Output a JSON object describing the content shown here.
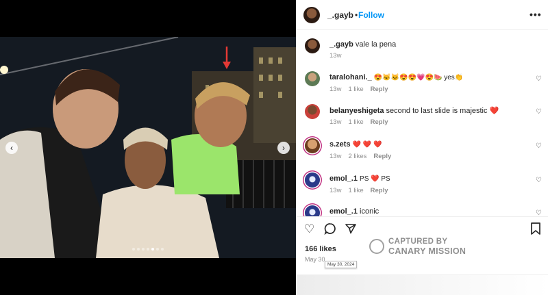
{
  "post": {
    "username": "_.gayb",
    "follow_label": "Follow",
    "separator": "•",
    "more_label": "•••"
  },
  "caption": {
    "username": "_.gayb",
    "text": "vale la pena",
    "age": "13w"
  },
  "comments": [
    {
      "username": "taralohani._",
      "text": "😍🐱🐱😍😍💗😍🍉 yes👏",
      "age": "13w",
      "likes": "1 like",
      "reply": "Reply"
    },
    {
      "username": "belanyeshigeta",
      "text": "second to last slide is majestic ❤️",
      "age": "13w",
      "likes": "1 like",
      "reply": "Reply"
    },
    {
      "username": "s.zets",
      "text": "❤️ ❤️ ❤️",
      "age": "13w",
      "likes": "2 likes",
      "reply": "Reply"
    },
    {
      "username": "emol_.1",
      "text": "PS ❤️ PS",
      "age": "13w",
      "likes": "1 like",
      "reply": "Reply"
    },
    {
      "username": "emol_.1",
      "text": "iconic",
      "age": "",
      "likes": "",
      "reply": ""
    }
  ],
  "actions": {
    "like_icon": "heart-outline-icon",
    "comment_icon": "comment-icon",
    "share_icon": "share-icon",
    "save_icon": "bookmark-icon"
  },
  "likes_count": "166 likes",
  "date": "May 30",
  "date_tooltip": "May 30, 2024",
  "watermark": {
    "line1": "CAPTURED BY",
    "line2": "CANARY MISSION"
  },
  "carousel": {
    "prev_label": "‹",
    "next_label": "›",
    "slide_count": 7,
    "active_slide": 4
  },
  "colors": {
    "follow": "#0095f6",
    "heart": "#e0245e",
    "arrow": "#e53935"
  }
}
